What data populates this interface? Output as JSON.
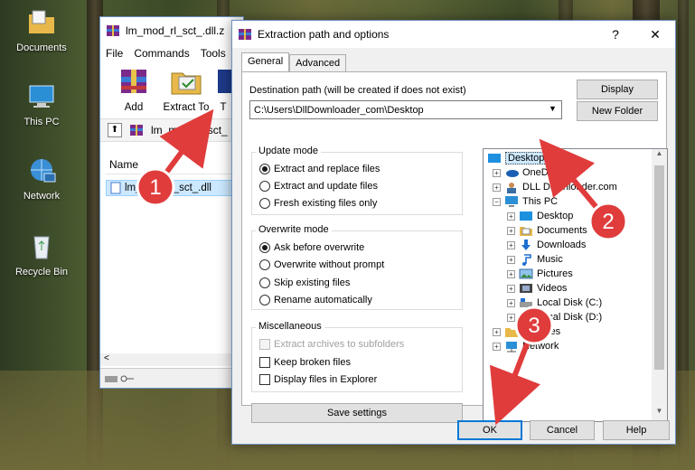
{
  "desktop": {
    "icons": [
      {
        "label": "Documents",
        "icon": "documents-folder-icon"
      },
      {
        "label": "This PC",
        "icon": "computer-icon"
      },
      {
        "label": "Network",
        "icon": "network-icon"
      },
      {
        "label": "Recycle Bin",
        "icon": "recycle-bin-icon"
      }
    ]
  },
  "winrar": {
    "title": "lm_mod_rl_sct_.dll.z",
    "menu": [
      "File",
      "Commands",
      "Tools"
    ],
    "toolbar": {
      "add": "Add",
      "extract_to": "Extract To",
      "third": "T"
    },
    "address": "lm_mod_rl_sct_",
    "list_header": "Name",
    "file_row": "lm_mod_rl_sct_.dll",
    "hscroll_left": "<"
  },
  "dialog": {
    "title": "Extraction path and options",
    "help_btn": "?",
    "close_btn": "✕",
    "tabs": [
      "General",
      "Advanced"
    ],
    "dest_label": "Destination path (will be created if does not exist)",
    "dest_value": "C:\\Users\\DllDownloader_com\\Desktop",
    "display_btn": "Display",
    "new_folder_btn": "New Folder",
    "update_mode": {
      "title": "Update mode",
      "options": [
        "Extract and replace files",
        "Extract and update files",
        "Fresh existing files only"
      ],
      "selected": 0
    },
    "overwrite_mode": {
      "title": "Overwrite mode",
      "options": [
        "Ask before overwrite",
        "Overwrite without prompt",
        "Skip existing files",
        "Rename automatically"
      ],
      "selected": 0
    },
    "misc": {
      "title": "Miscellaneous",
      "options": [
        "Extract archives to subfolders",
        "Keep broken files",
        "Display files in Explorer"
      ]
    },
    "save_settings": "Save settings",
    "tree": {
      "desktop": "Desktop",
      "onedrive": "OneDrive",
      "dlldownloader": "DLL Downloader.com",
      "thispc": "This PC",
      "children": [
        "Desktop",
        "Documents",
        "Downloads",
        "Music",
        "Pictures",
        "Videos",
        "Local Disk (C:)",
        "Local Disk (D:)"
      ],
      "libraries": "Libraries",
      "network": "Network"
    },
    "ok": "OK",
    "cancel": "Cancel",
    "help": "Help"
  },
  "annotations": {
    "step1": "1",
    "step2": "2",
    "step3": "3",
    "color": "#e03c3c"
  }
}
